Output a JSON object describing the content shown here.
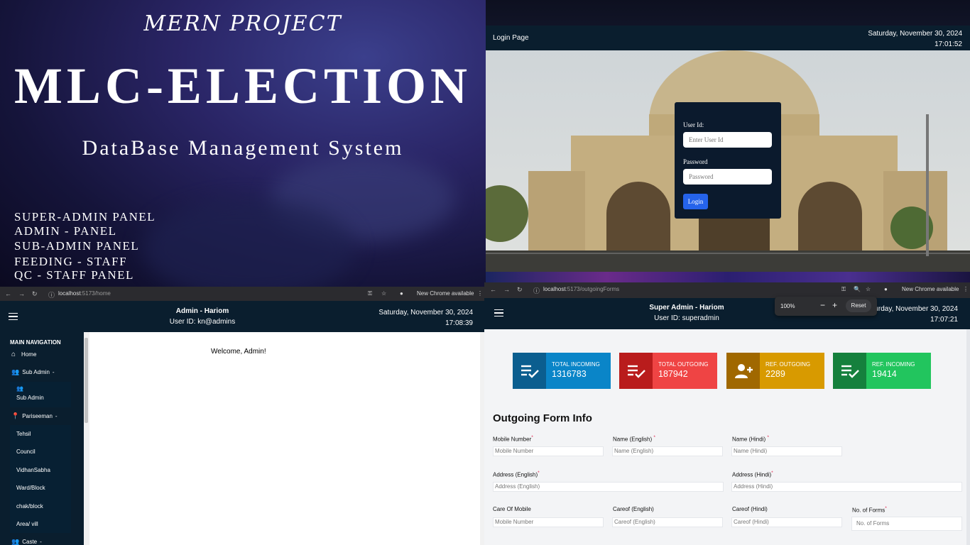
{
  "banner": {
    "subtitle_top": "MERN PROJECT",
    "title": "MLC-ELECTION",
    "subtitle": "DataBase Management System",
    "panels": [
      "SUPER-ADMIN PANEL",
      "ADMIN - PANEL",
      "SUB-ADMIN PANEL",
      "FEEDING - STAFF",
      "QC - STAFF PANEL"
    ]
  },
  "login": {
    "page_label": "Login Page",
    "date": "Saturday, November 30, 2024",
    "time": "17:01:52",
    "user_id_label": "User Id:",
    "user_id_placeholder": "Enter User Id",
    "password_label": "Password",
    "password_placeholder": "Password",
    "login_button": "Login"
  },
  "admin_browser": {
    "url_host": "localhost",
    "url_path": ":5173/home",
    "new_chrome": "New Chrome available"
  },
  "admin": {
    "header_title": "Admin - Hariom",
    "user_id": "User ID: kn@admins",
    "date": "Saturday, November 30, 2024",
    "time": "17:08:39",
    "nav_title": "MAIN NAVIGATION",
    "nav": {
      "home": "Home",
      "sub_admin": "Sub Admin",
      "sub_admin_child": "Sub Admin",
      "pariseeman": "Pariseeman",
      "pariseeman_children": [
        "Tehsil",
        "Council",
        "VidhanSabha",
        "Ward/Block",
        "chak/block",
        "Area/ vill"
      ],
      "caste": "Caste"
    },
    "welcome": "Welcome, Admin!"
  },
  "super_browser": {
    "url_host": "localhost",
    "url_path": ":5173/outgoingForms",
    "new_chrome": "New Chrome available",
    "zoom": "100%",
    "zoom_minus": "−",
    "zoom_plus": "+",
    "zoom_reset": "Reset"
  },
  "super": {
    "header_title": "Super Admin - Hariom",
    "user_id": "User ID: superadmin",
    "date": "aturday, November 30, 2024",
    "time": "17:07:21",
    "cards": [
      {
        "label": "TOTAL INCOMING",
        "value": "1316783",
        "icon": "list-check-icon",
        "color": "#0a85c8",
        "icon_bg": "#0b5e8f"
      },
      {
        "label": "TOTAL OUTGOING",
        "value": "187942",
        "icon": "list-check-icon",
        "color": "#ef4444",
        "icon_bg": "#b91c1c"
      },
      {
        "label": "REF. OUTGOING",
        "value": "2289",
        "icon": "person-add-icon",
        "color": "#d89a00",
        "icon_bg": "#a06800"
      },
      {
        "label": "REF. INCOMING",
        "value": "19414",
        "icon": "list-check-icon",
        "color": "#22c55e",
        "icon_bg": "#15803d"
      }
    ],
    "form_title": "Outgoing Form Info",
    "fields": {
      "mobile_label": "Mobile Number",
      "mobile_placeholder": "Mobile Number",
      "name_en_label": "Name (English)",
      "name_en_placeholder": "Name (English)",
      "name_hi_label": "Name (Hindi)",
      "name_hi_placeholder": "Name (Hindi)",
      "addr_en_label": "Address (English)",
      "addr_en_placeholder": "Address (English)",
      "addr_hi_label": "Address (Hindi)",
      "addr_hi_placeholder": "Address (Hindi)",
      "care_mobile_label": "Care Of Mobile",
      "care_mobile_placeholder": "Mobile Number",
      "careof_en_label": "Careof (English)",
      "careof_en_placeholder": "Careof (English)",
      "careof_hi_label": "Careof (Hindi)",
      "careof_hi_placeholder": "Careof (Hindi)",
      "forms_label": "No. of Forms",
      "forms_placeholder": "No. of Forms"
    }
  }
}
